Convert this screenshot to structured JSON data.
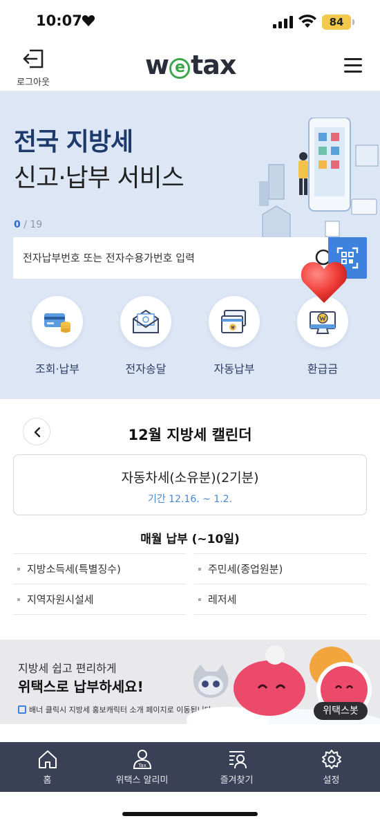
{
  "status_bar": {
    "time": "10:07",
    "battery": "84"
  },
  "header": {
    "logout_label": "로그아웃",
    "logo_left": "w",
    "logo_mark": "e",
    "logo_right": "tax"
  },
  "hero": {
    "title_line1": "전국 지방세",
    "title_line2": "신고·납부 서비스",
    "counter_current": "0",
    "counter_separator": " / ",
    "counter_total": "19"
  },
  "search": {
    "placeholder": "전자납부번호 또는 전자수용가번호 입력"
  },
  "quick_menu": [
    {
      "label": "조회·납부",
      "icon": "card-coins-icon"
    },
    {
      "label": "전자송달",
      "icon": "mail-icon"
    },
    {
      "label": "자동납부",
      "icon": "auto-pay-icon"
    },
    {
      "label": "환급금",
      "icon": "refund-icon"
    }
  ],
  "calendar": {
    "title": "12월 지방세 캘린더",
    "card_title": "자동차세(소유분)(2기분)",
    "card_period": "기간 12.16. ~ 1.2.",
    "monthly_title": "매월 납부 (~10일)",
    "monthly_items": [
      "지방소득세(특별징수)",
      "주민세(종업원분)",
      "지역자원시설세",
      "레저세"
    ]
  },
  "banner": {
    "subtitle": "지방세 쉽고 편리하게",
    "headline": "위택스로 납부하세요!",
    "note": "배너 클릭시 지방세 홍보캐릭터 소개 페이지로 이동됩니다.",
    "chatbot_label": "위택스봇"
  },
  "bottom_nav": [
    {
      "label": "홈",
      "icon": "home-icon"
    },
    {
      "label": "위택스 알리미",
      "icon": "tax-person-icon"
    },
    {
      "label": "즐겨찾기",
      "icon": "favorites-icon"
    },
    {
      "label": "설정",
      "icon": "settings-icon"
    }
  ],
  "colors": {
    "accent": "#3d83de",
    "hero_bg": "#dce6f4",
    "nav_bg": "#3a4156",
    "logo_green": "#3aa54a"
  }
}
